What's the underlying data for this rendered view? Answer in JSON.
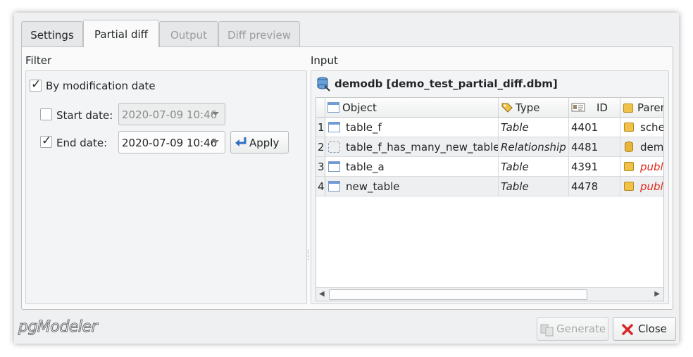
{
  "tabs": [
    {
      "label": "Settings",
      "state": "normal"
    },
    {
      "label": "Partial diff",
      "state": "active"
    },
    {
      "label": "Output",
      "state": "disabled"
    },
    {
      "label": "Diff preview",
      "state": "disabled"
    }
  ],
  "filter": {
    "title": "Filter",
    "by_mod_date": {
      "label": "By modification date",
      "checked": true
    },
    "start_date": {
      "label": "Start date:",
      "checked": false,
      "value": "2020-07-09 10:46",
      "enabled": false
    },
    "end_date": {
      "label": "End date:",
      "checked": true,
      "value": "2020-07-09 10:46",
      "enabled": true
    },
    "apply_label": "Apply"
  },
  "input": {
    "title": "Input",
    "db_title": "demodb [demo_test_partial_diff.dbm]",
    "columns": [
      "Object",
      "Type",
      "ID",
      "Parent"
    ],
    "rows": [
      {
        "num": "1",
        "object": "table_f",
        "type": "Table",
        "id": "4401",
        "parent": "schema",
        "parent_icon": "schema-icon",
        "object_icon": "table-icon"
      },
      {
        "num": "2",
        "object": "table_f_has_many_new_table",
        "type": "Relationship",
        "id": "4481",
        "parent": "demodb",
        "parent_icon": "database-icon",
        "object_icon": "relationship-icon"
      },
      {
        "num": "3",
        "object": "table_a",
        "type": "Table",
        "id": "4391",
        "parent": "public",
        "parent_icon": "schema-icon",
        "object_icon": "table-icon"
      },
      {
        "num": "4",
        "object": "new_table",
        "type": "Table",
        "id": "4478",
        "parent": "public",
        "parent_icon": "schema-icon",
        "object_icon": "table-icon"
      }
    ]
  },
  "footer": {
    "logo": "pgModeler",
    "generate_label": "Generate",
    "close_label": "Close"
  },
  "colors": {
    "accent": "#3daee9",
    "close_red": "#d7262b",
    "parent_red": "#e0261a"
  }
}
